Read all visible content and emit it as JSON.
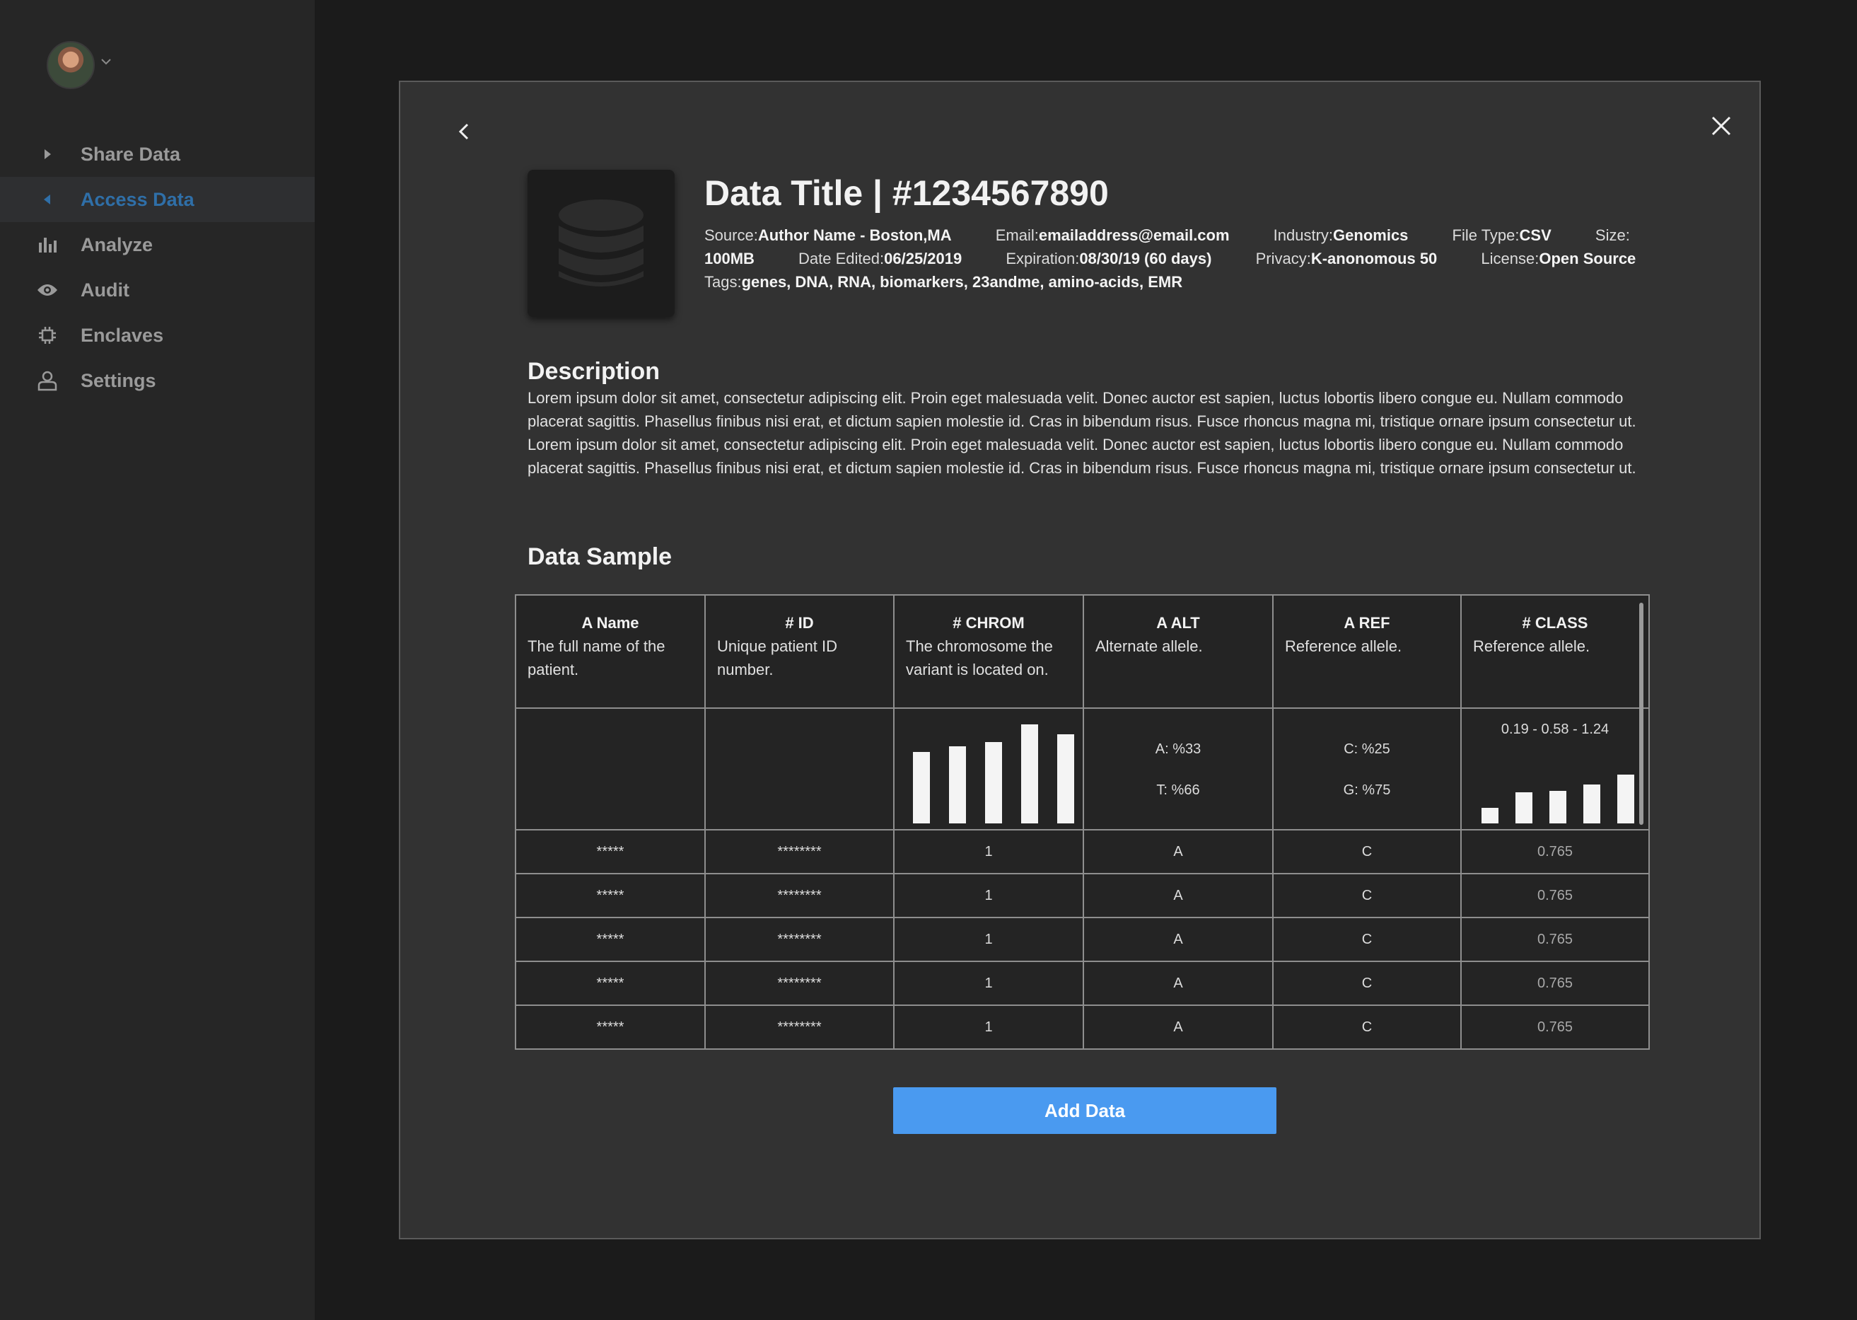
{
  "sidebar": {
    "items": [
      {
        "label": "Share Data",
        "icon": "caret-right-icon"
      },
      {
        "label": "Access Data",
        "icon": "caret-left-icon",
        "active": true
      },
      {
        "label": "Analyze",
        "icon": "bar-chart-icon"
      },
      {
        "label": "Audit",
        "icon": "eye-icon"
      },
      {
        "label": "Enclaves",
        "icon": "chip-icon"
      },
      {
        "label": "Settings",
        "icon": "user-icon"
      }
    ],
    "accent_color": "#2f6fa8"
  },
  "dataset": {
    "title": "Data Title | #1234567890",
    "meta": {
      "source_label": "Source:",
      "source": "Author Name - Boston,MA",
      "email_label": "Email:",
      "email": "emailaddress@email.com",
      "industry_label": "Industry:",
      "industry": "Genomics",
      "filetype_label": "File Type:",
      "filetype": "CSV",
      "size_label": "Size:",
      "size": "100MB",
      "edited_label": "Date Edited:",
      "edited": "06/25/2019",
      "expiration_label": "Expiration:",
      "expiration": "08/30/19 (60 days)",
      "privacy_label": "Privacy:",
      "privacy": "K-anonomous 50",
      "license_label": "License:",
      "license": "Open Source",
      "tags_label": "Tags:",
      "tags": "genes, DNA, RNA, biomarkers, 23andme, amino-acids, EMR"
    },
    "description_heading": "Description",
    "description": "Lorem ipsum dolor sit amet, consectetur adipiscing elit. Proin eget malesuada velit. Donec auctor est sapien, luctus lobortis libero congue eu. Nullam commodo placerat sagittis. Phasellus finibus nisi erat, et dictum sapien molestie id. Cras in bibendum risus. Fusce rhoncus magna mi, tristique ornare ipsum consectetur ut. Lorem ipsum dolor sit amet, consectetur adipiscing elit. Proin eget malesuada velit. Donec auctor est sapien, luctus lobortis libero congue eu. Nullam commodo placerat sagittis. Phasellus finibus nisi erat, et dictum sapien molestie id. Cras in bibendum risus. Fusce rhoncus magna mi, tristique ornare ipsum consectetur ut.",
    "sample_heading": "Data Sample"
  },
  "table": {
    "columns": [
      {
        "name": "A Name",
        "desc": "The full name of the patient."
      },
      {
        "name": "# ID",
        "desc": "Unique patient ID number."
      },
      {
        "name": "# CHROM",
        "desc": "The chromosome the variant is located on."
      },
      {
        "name": "A ALT",
        "desc": "Alternate allele."
      },
      {
        "name": "A REF",
        "desc": "Reference allele."
      },
      {
        "name": "# CLASS",
        "desc": "Reference allele."
      }
    ],
    "stats": {
      "alt_a": "A: %33",
      "alt_t": "T: %66",
      "ref_c": "C: %25",
      "ref_g": "G: %75",
      "class_range": "0.19 - 0.58 - 1.24"
    },
    "chrom_hist": [
      0.72,
      0.78,
      0.82,
      1.0,
      0.9
    ],
    "class_hist": [
      0.22,
      0.44,
      0.46,
      0.55,
      0.69
    ],
    "rows": [
      [
        "*****",
        "********",
        "1",
        "A",
        "C",
        "0.765"
      ],
      [
        "*****",
        "********",
        "1",
        "A",
        "C",
        "0.765"
      ],
      [
        "*****",
        "********",
        "1",
        "A",
        "C",
        "0.765"
      ],
      [
        "*****",
        "********",
        "1",
        "A",
        "C",
        "0.765"
      ],
      [
        "*****",
        "********",
        "1",
        "A",
        "C",
        "0.765"
      ]
    ]
  },
  "actions": {
    "add_data": "Add Data"
  }
}
